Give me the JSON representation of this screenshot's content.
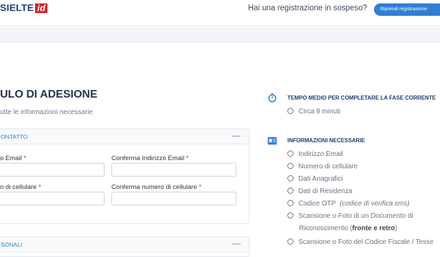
{
  "header": {
    "logo_text": "SIELTE",
    "logo_id": "id",
    "pending_text": "Hai una registrazione in sospeso?",
    "resume_button": "Riprendi registrazione"
  },
  "main": {
    "title": "ULO DI ADESIONE",
    "subtitle": "utte le informazioni necessarie",
    "contact_section": {
      "title": "ONTATTO",
      "toggle": "—",
      "email_label": "o Email",
      "confirm_email_label": "Conferma Indirizzo Email",
      "phone_label": "o di cellulare",
      "confirm_phone_label": "Conferma numero di cellulare",
      "required_mark": "*"
    },
    "personal_section": {
      "title": "SONALI",
      "toggle": "—"
    }
  },
  "sidebar": {
    "time_title": "TEMPO MEDIO PER COMPLETARE LA FASE CORRENTE",
    "time_value": "Circa 8 minuti",
    "info_title": "INFORMAZIONI NECESSARIE",
    "items": [
      "Indirizzo Email",
      "Numero di cellulare",
      "Dati Anagrafici",
      "Dati di Residenza",
      "Codice OTP",
      "Scansione o Foto di un Documento di",
      "Scansione o Foto del Codice Fiscale / Tesse"
    ],
    "otp_note": "(codice di verifica sms)",
    "doc_line2_prefix": "Riconoscimento (",
    "doc_line2_bold": "fronte e retro",
    "doc_line2_suffix": ")"
  },
  "colors": {
    "brand_blue": "#2f7fd3",
    "brand_navy": "#1f3d77",
    "brand_red": "#d8232a"
  },
  "icons": {
    "timer": "stopwatch-icon",
    "info": "id-card-icon",
    "bullet": "circle-bullet-icon"
  }
}
